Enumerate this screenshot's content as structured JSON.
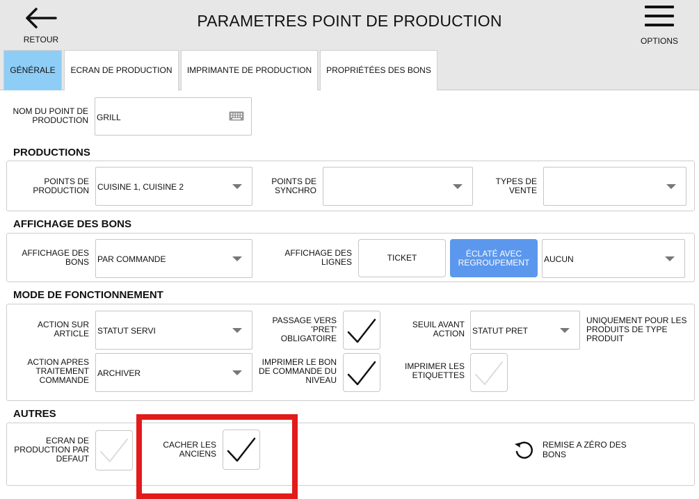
{
  "header": {
    "title": "PARAMETRES POINT DE PRODUCTION",
    "back_label": "RETOUR",
    "options_label": "OPTIONS"
  },
  "tabs": [
    {
      "label": "GÉNÉRALE",
      "active": true
    },
    {
      "label": "ECRAN DE PRODUCTION",
      "active": false
    },
    {
      "label": "IMPRIMANTE DE PRODUCTION",
      "active": false
    },
    {
      "label": "PROPRIÉTÉES DES BONS",
      "active": false
    }
  ],
  "name_field": {
    "label_line1": "NOM DU POINT DE",
    "label_line2": "PRODUCTION",
    "value": "GRILL",
    "icon": "keyboard-icon"
  },
  "productions": {
    "title": "PRODUCTIONS",
    "points_label_1": "POINTS DE",
    "points_label_2": "PRODUCTION",
    "points_value": "CUISINE 1, CUISINE 2",
    "synchro_label_1": "POINTS DE",
    "synchro_label_2": "SYNCHRO",
    "synchro_value": "",
    "vente_label_1": "TYPES DE",
    "vente_label_2": "VENTE",
    "vente_value": ""
  },
  "affichage": {
    "title": "AFFICHAGE DES BONS",
    "bons_label_1": "AFFICHAGE DES",
    "bons_label_2": "BONS",
    "bons_value": "PAR COMMANDE",
    "lignes_label_1": "AFFICHAGE DES",
    "lignes_label_2": "LIGNES",
    "ticket_label": "TICKET",
    "eclate_label_1": "ÉCLATÉ AVEC",
    "eclate_label_2": "REGROUPEMENT",
    "regroup_value": "AUCUN"
  },
  "mode": {
    "title": "MODE DE FONCTIONNEMENT",
    "action_article_1": "ACTION SUR",
    "action_article_2": "ARTICLE",
    "action_article_value": "STATUT SERVI",
    "passage_1": "PASSAGE VERS",
    "passage_2": "'PRET'",
    "passage_3": "OBLIGATOIRE",
    "passage_checked": true,
    "seuil_1": "SEUIL AVANT",
    "seuil_2": "ACTION",
    "seuil_value": "STATUT PRET",
    "note_1": "UNIQUEMENT POUR LES",
    "note_2": "PRODUITS DE TYPE",
    "note_3": "PRODUIT",
    "action_apres_1": "ACTION APRES",
    "action_apres_2": "TRAITEMENT",
    "action_apres_3": "COMMANDE",
    "action_apres_value": "ARCHIVER",
    "imprimer_bon_1": "IMPRIMER LE BON",
    "imprimer_bon_2": "DE COMMANDE DU",
    "imprimer_bon_3": "NIVEAU",
    "imprimer_bon_checked": true,
    "imprimer_etiq_1": "IMPRIMER LES",
    "imprimer_etiq_2": "ETIQUETTES",
    "imprimer_etiq_checked": false
  },
  "autres": {
    "title": "AUTRES",
    "ecran_1": "ECRAN DE",
    "ecran_2": "PRODUCTION PAR",
    "ecran_3": "DEFAUT",
    "ecran_checked": false,
    "cacher_1": "CACHER LES",
    "cacher_2": "ANCIENS",
    "cacher_checked": true,
    "reset_1": "REMISE A ZÉRO DES",
    "reset_2": "BONS"
  },
  "colors": {
    "active_tab": "#8ecdf6",
    "active_button": "#5b97ec",
    "highlight": "#e21b1b"
  }
}
